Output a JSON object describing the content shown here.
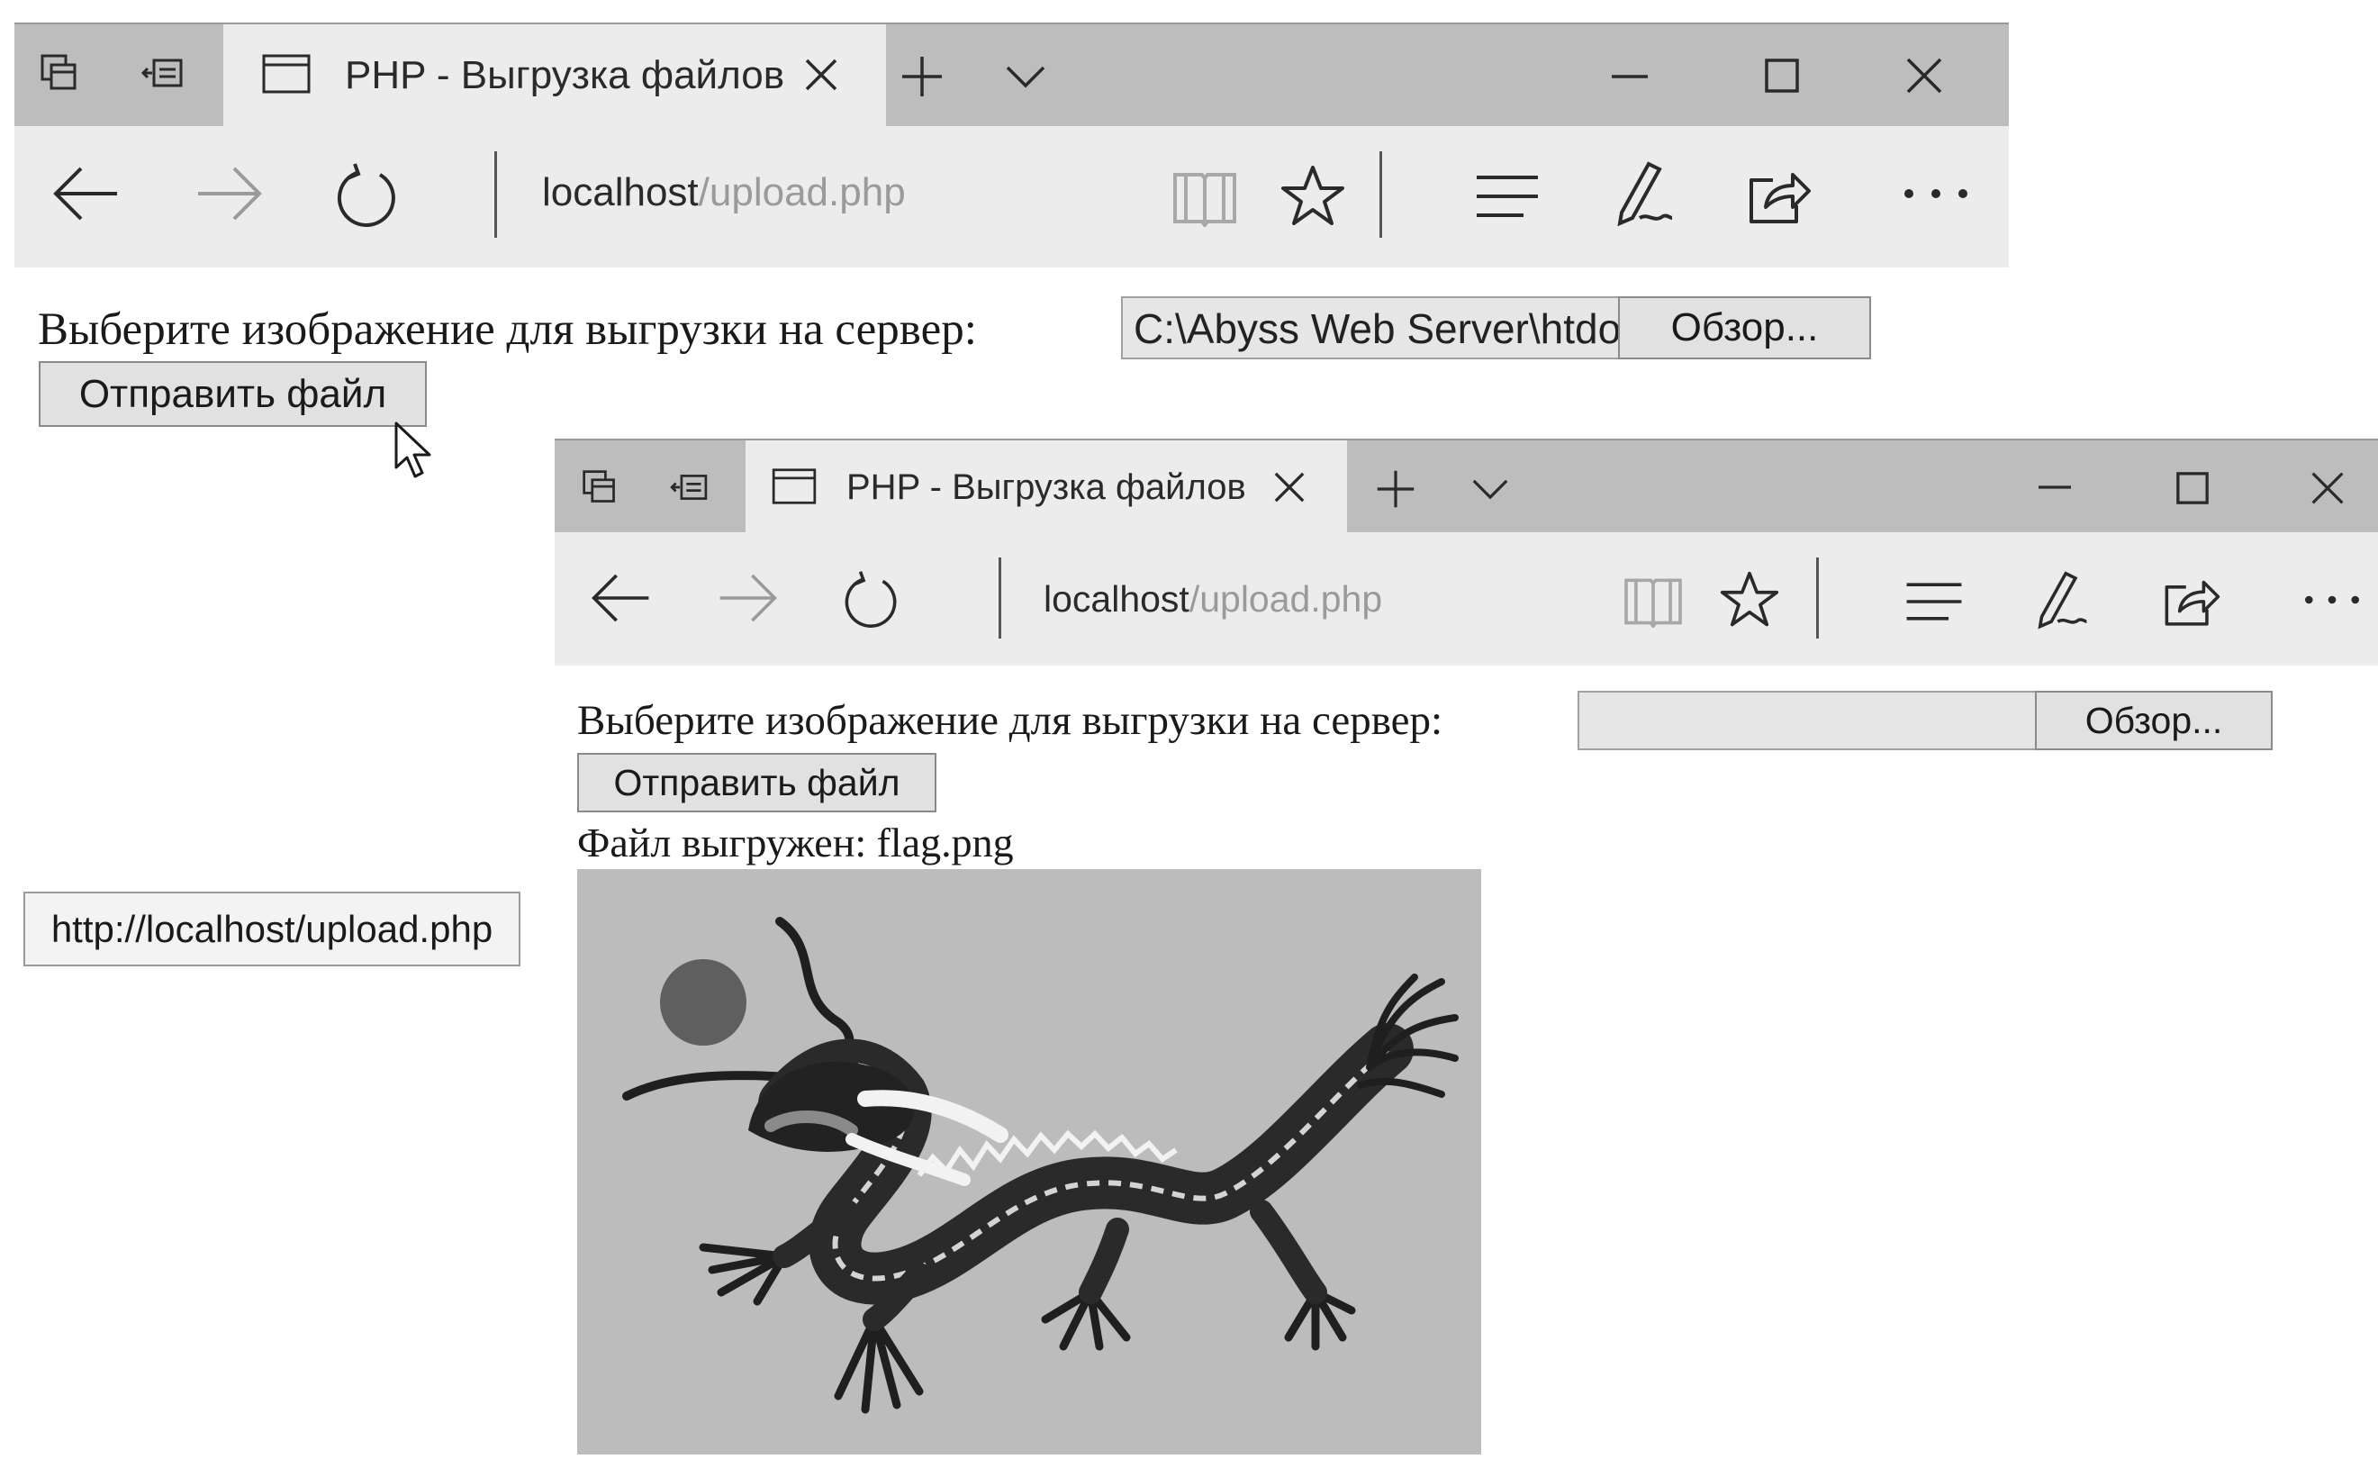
{
  "window1": {
    "tab_title": "PHP - Выгрузка файлов",
    "address": {
      "host": "localhost",
      "path": "/upload.php"
    }
  },
  "page1": {
    "prompt": "Выберите изображение для выгрузки на сервер:",
    "file_value": "C:\\Abyss Web Server\\htdocs",
    "browse_label": "Обзор...",
    "submit_label": "Отправить файл"
  },
  "tooltip": {
    "text": "http://localhost/upload.php"
  },
  "window2": {
    "tab_title": "PHP - Выгрузка файлов",
    "address": {
      "host": "localhost",
      "path": "/upload.php"
    }
  },
  "page2": {
    "prompt": "Выберите изображение для выгрузки на сервер:",
    "file_value": "",
    "browse_label": "Обзор...",
    "submit_label": "Отправить файл",
    "result_text": "Файл выгружен: flag.png"
  },
  "icons": [
    "tab-preview-icon",
    "tab-aside-icon",
    "tab-page-icon",
    "close-tab-icon",
    "new-tab-icon",
    "tab-list-chevron-icon",
    "minimize-icon",
    "maximize-icon",
    "close-window-icon",
    "back-icon",
    "forward-icon",
    "refresh-icon",
    "reading-view-icon",
    "favorite-star-icon",
    "hub-icon",
    "web-note-icon",
    "share-icon",
    "more-icon",
    "mouse-cursor-icon"
  ],
  "colors": {
    "tabbar": "#bdbdbd",
    "active_tab": "#ececec",
    "url_path": "#9a9a9a",
    "flag_background": "#bcbcbc"
  }
}
